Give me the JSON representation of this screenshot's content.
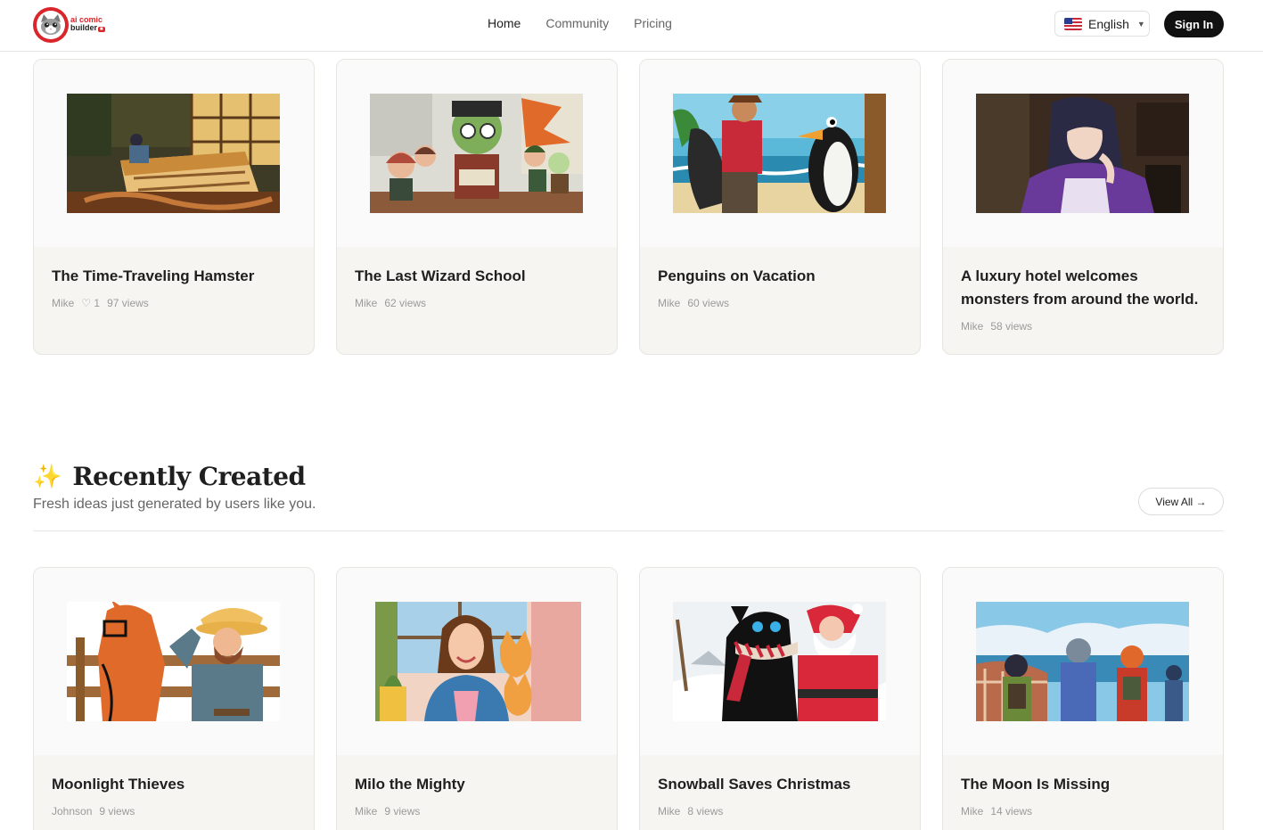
{
  "header": {
    "logo_line1": "ai comic",
    "logo_line2": "builder",
    "nav": [
      {
        "label": "Home",
        "active": true
      },
      {
        "label": "Community",
        "active": false
      },
      {
        "label": "Pricing",
        "active": false
      }
    ],
    "language": "English",
    "sign_in": "Sign In"
  },
  "featured": [
    {
      "title": "The Time-Traveling Hamster",
      "author": "Mike",
      "likes": "♡ 1",
      "views": "97 views"
    },
    {
      "title": "The Last Wizard School",
      "author": "Mike",
      "views": "62 views"
    },
    {
      "title": "Penguins on Vacation",
      "author": "Mike",
      "views": "60 views"
    },
    {
      "title": "A luxury hotel welcomes monsters from around the world.",
      "author": "Mike",
      "views": "58 views"
    }
  ],
  "recent_section": {
    "icon": "sparkle-icon",
    "title": "Recently Created",
    "subtitle": "Fresh ideas just generated by users like you.",
    "view_all": "View All →"
  },
  "recent": [
    {
      "title": "Moonlight Thieves",
      "author": "Johnson",
      "views": "9 views"
    },
    {
      "title": "Milo the Mighty",
      "author": "Mike",
      "views": "9 views"
    },
    {
      "title": "Snowball Saves Christmas",
      "author": "Mike",
      "views": "8 views"
    },
    {
      "title": "The Moon Is Missing",
      "author": "Mike",
      "views": "14 views"
    }
  ],
  "colors": {
    "brand": "#d8262a",
    "card_bg": "#f6f5f1",
    "button_dark": "#111111"
  }
}
